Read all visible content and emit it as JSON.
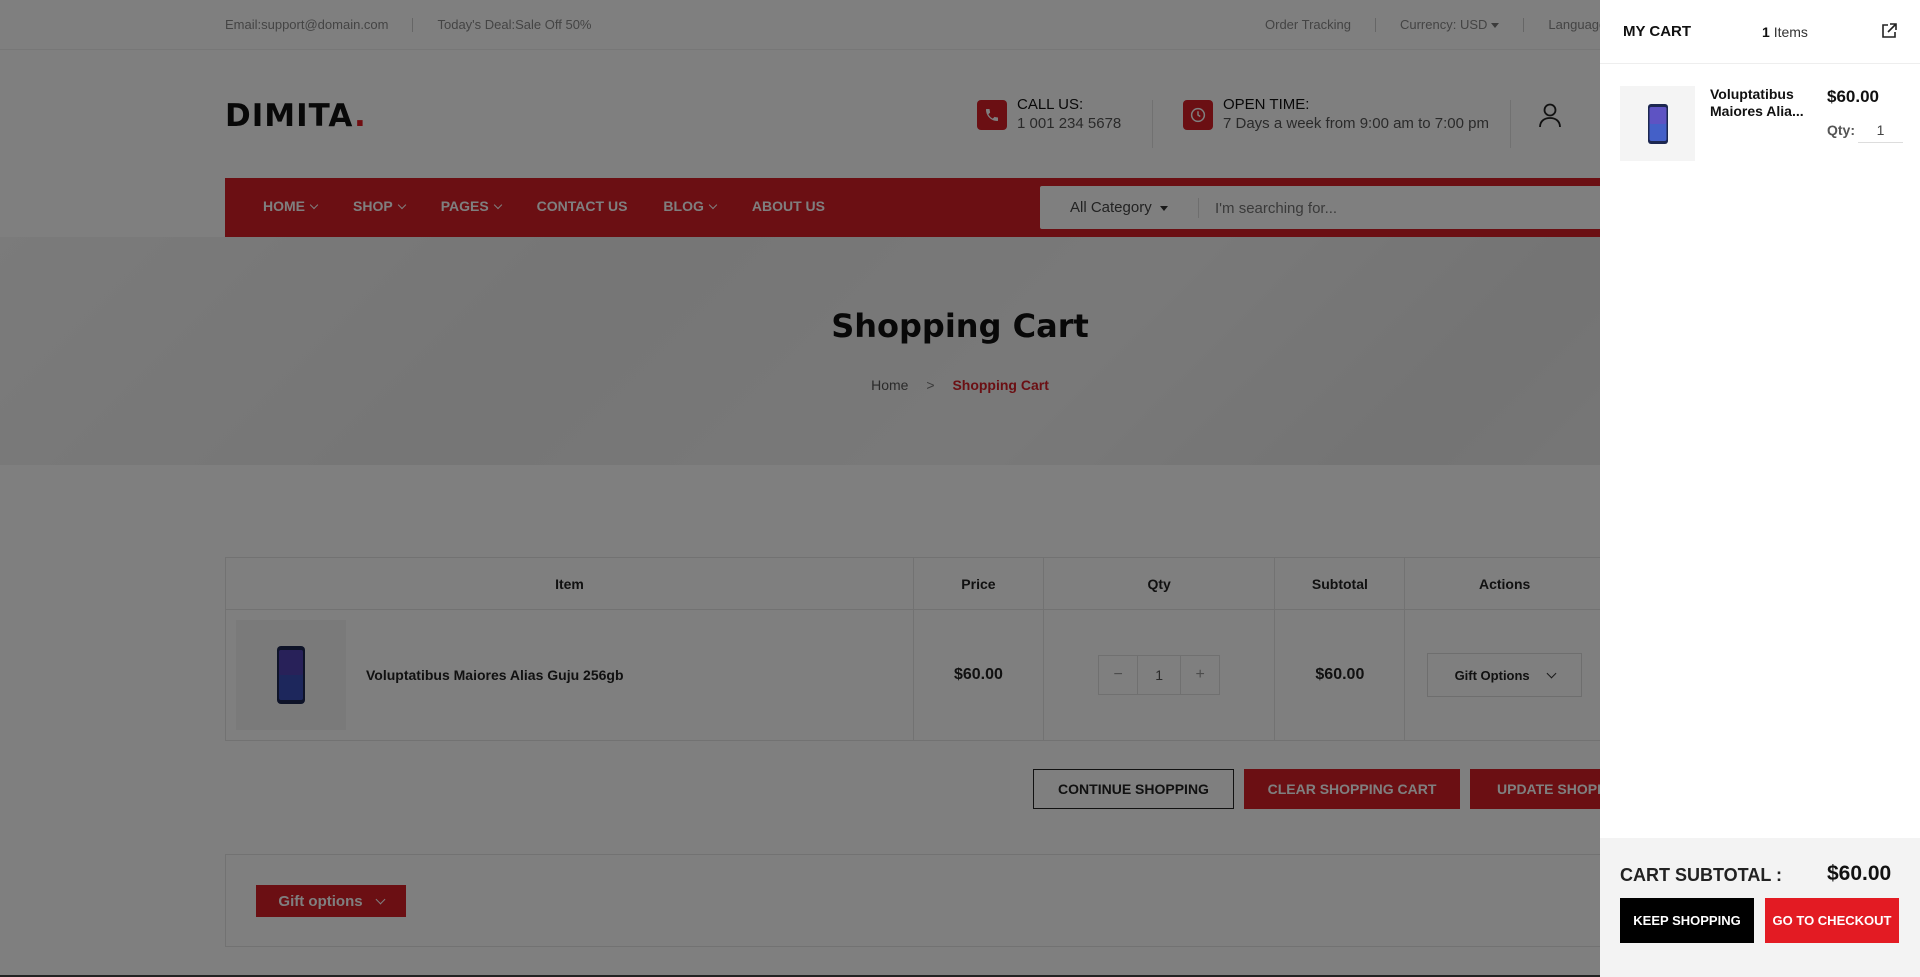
{
  "topbar": {
    "email": "Email:support@domain.com",
    "deal": "Today's Deal:Sale Off 50%",
    "order_tracking": "Order Tracking",
    "currency_label": "Currency:",
    "currency_value": "USD",
    "language": "Language"
  },
  "header": {
    "logo_text": "DIMITA",
    "logo_dot": ".",
    "call_label": "CALL US:",
    "call_value": "1 001 234 5678",
    "open_label": "OPEN TIME:",
    "open_value": "7 Days a week from 9:00 am to 7:00 pm"
  },
  "nav": {
    "items": [
      {
        "label": "HOME",
        "dropdown": true
      },
      {
        "label": "SHOP",
        "dropdown": true
      },
      {
        "label": "PAGES",
        "dropdown": true
      },
      {
        "label": "CONTACT US",
        "dropdown": false
      },
      {
        "label": "BLOG",
        "dropdown": true
      },
      {
        "label": "ABOUT US",
        "dropdown": false
      }
    ],
    "category": "All Category",
    "search_placeholder": "I'm searching for..."
  },
  "banner": {
    "title": "Shopping Cart",
    "crumb_home": "Home",
    "crumb_sep": ">",
    "crumb_current": "Shopping Cart"
  },
  "cart_table": {
    "headers": {
      "item": "Item",
      "price": "Price",
      "qty": "Qty",
      "subtotal": "Subtotal",
      "actions": "Actions"
    },
    "rows": [
      {
        "name": "Voluptatibus Maiores Alias Guju 256gb",
        "price": "$60.00",
        "qty": "1",
        "subtotal": "$60.00",
        "action": "Gift Options"
      }
    ]
  },
  "actions": {
    "continue": "CONTINUE SHOPPING",
    "clear": "CLEAR SHOPPING CART",
    "update": "UPDATE SHOPPING CART"
  },
  "gift_section": {
    "button": "Gift options"
  },
  "minicart": {
    "title": "MY CART",
    "count": "1",
    "count_suffix": "Items",
    "item": {
      "name": "Voluptatibus Maiores Alia...",
      "price": "$60.00",
      "qty_label": "Qty:",
      "qty": "1"
    },
    "subtotal_label": "CART SUBTOTAL :",
    "subtotal_value": "$60.00",
    "keep_shopping": "KEEP SHOPPING",
    "checkout": "GO TO CHECKOUT"
  },
  "colors": {
    "accent": "#d61e26",
    "overlay": "rgba(0,0,0,0.5)"
  }
}
